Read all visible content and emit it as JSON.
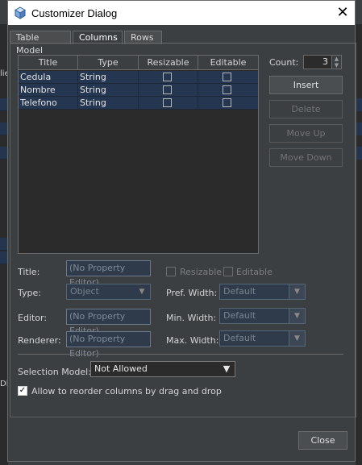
{
  "window": {
    "title": "Customizer Dialog",
    "close_glyph": "✕"
  },
  "tabs": [
    "Table Model",
    "Columns",
    "Rows"
  ],
  "table": {
    "columns": [
      "Title",
      "Type",
      "Resizable",
      "Editable"
    ],
    "rows": [
      {
        "title": "Cedula",
        "type": "String"
      },
      {
        "title": "Nombre",
        "type": "String"
      },
      {
        "title": "Telefono",
        "type": "String"
      }
    ]
  },
  "count": {
    "label": "Count:",
    "value": "3"
  },
  "buttons": {
    "insert": "Insert",
    "delete": "Delete",
    "move_up": "Move Up",
    "move_down": "Move Down",
    "close": "Close"
  },
  "properties": {
    "title_label": "Title:",
    "title_value": "(No Property Editor)",
    "resizable_label": "Resizable",
    "editable_label": "Editable",
    "type_label": "Type:",
    "type_value": "Object",
    "pref_width_label": "Pref. Width:",
    "pref_width_value": "Default",
    "editor_label": "Editor:",
    "editor_value": "(No Property Editor)",
    "min_width_label": "Min. Width:",
    "min_width_value": "Default",
    "renderer_label": "Renderer:",
    "renderer_value": "(No Property Editor)",
    "max_width_label": "Max. Width:",
    "max_width_value": "Default"
  },
  "selection_model": {
    "label": "Selection Model:",
    "value": "Not Allowed"
  },
  "reorder": {
    "label": "Allow to reorder columns by drag and drop",
    "checked": true
  },
  "background_text": {
    "left_fragment": "lie",
    "bottom_fragment": "Dl"
  }
}
